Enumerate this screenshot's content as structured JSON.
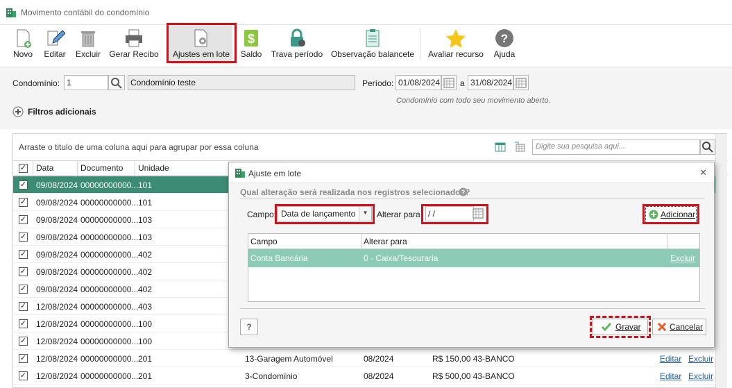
{
  "window": {
    "title": "Movimento contábil do condomínio"
  },
  "toolbar": {
    "novo": "Novo",
    "editar": "Editar",
    "excluir": "Excluir",
    "gerar_recibo": "Gerar Recibo",
    "ajustes_em_lote": "Ajustes em lote",
    "saldo": "Saldo",
    "trava_periodo": "Trava período",
    "observacao_balancete": "Observação balancete",
    "avaliar_recurso": "Avaliar recurso",
    "ajuda": "Ajuda"
  },
  "filters": {
    "condominio_label": "Condomínio:",
    "condominio_code": "1",
    "condominio_name": "Condomínio teste",
    "periodo_label": "Período:",
    "periodo_start": "01/08/2024",
    "periodo_sep": "a",
    "periodo_end": "31/08/2024",
    "status_text": "Condomínio com todo seu movimento aberto.",
    "filtros_adicionais": "Filtros adicionais"
  },
  "grid": {
    "group_hint": "Arraste o titulo de uma coluna aqui para agrupar por essa coluna",
    "search_placeholder": "Digite sua pesquisa aqui...",
    "columns": [
      "Data",
      "Documento",
      "Unidade"
    ],
    "rows": [
      {
        "data": "09/08/2024",
        "documento": "00000000000...",
        "unidade": "101",
        "selected": true
      },
      {
        "data": "09/08/2024",
        "documento": "00000000000...",
        "unidade": "101"
      },
      {
        "data": "09/08/2024",
        "documento": "00000000000...",
        "unidade": "103"
      },
      {
        "data": "09/08/2024",
        "documento": "00000000000...",
        "unidade": "103"
      },
      {
        "data": "09/08/2024",
        "documento": "00000000000...",
        "unidade": "402"
      },
      {
        "data": "09/08/2024",
        "documento": "00000000000...",
        "unidade": "402"
      },
      {
        "data": "09/08/2024",
        "documento": "00000000000...",
        "unidade": "402"
      },
      {
        "data": "12/08/2024",
        "documento": "00000000000...",
        "unidade": "403"
      },
      {
        "data": "12/08/2024",
        "documento": "00000000000...",
        "unidade": "100"
      },
      {
        "data": "12/08/2024",
        "documento": "00000000000...",
        "unidade": "100"
      },
      {
        "data": "12/08/2024",
        "documento": "00000000000...",
        "unidade": "201",
        "conta": "13-Garagem Automóvel",
        "competencia": "08/2024",
        "valor": "R$ 150,00 43-BANCO",
        "editar": "Editar",
        "excluir": "Excluir"
      },
      {
        "data": "12/08/2024",
        "documento": "00000000000...",
        "unidade": "201",
        "conta": "3-Condomínio",
        "competencia": "08/2024",
        "valor": "R$ 500,00 43-BANCO",
        "editar": "Editar",
        "excluir": "Excluir"
      }
    ]
  },
  "dialog": {
    "title": "Ajuste em lote",
    "question": "Qual alteração será realizada nos registros selecionados?",
    "campo_label": "Campo:",
    "campo_value": "Data de lançamento",
    "alterar_para_label": "Alterar para",
    "alterar_para_value": " /  /",
    "adicionar": "Adicionar",
    "table": {
      "col_campo": "Campo",
      "col_alterar": "Alterar para",
      "rows": [
        {
          "campo": "Conta Bancária",
          "alterar": "0 - Caixa/Tesouraria",
          "excluir": "Excluir"
        }
      ]
    },
    "help": "?",
    "gravar": "Gravar",
    "cancelar": "Cancelar"
  },
  "colors": {
    "highlight": "#d0121c",
    "selected_row": "#3c8c75",
    "dialog_row": "#8ccbb5",
    "link": "#1f5fa8"
  }
}
